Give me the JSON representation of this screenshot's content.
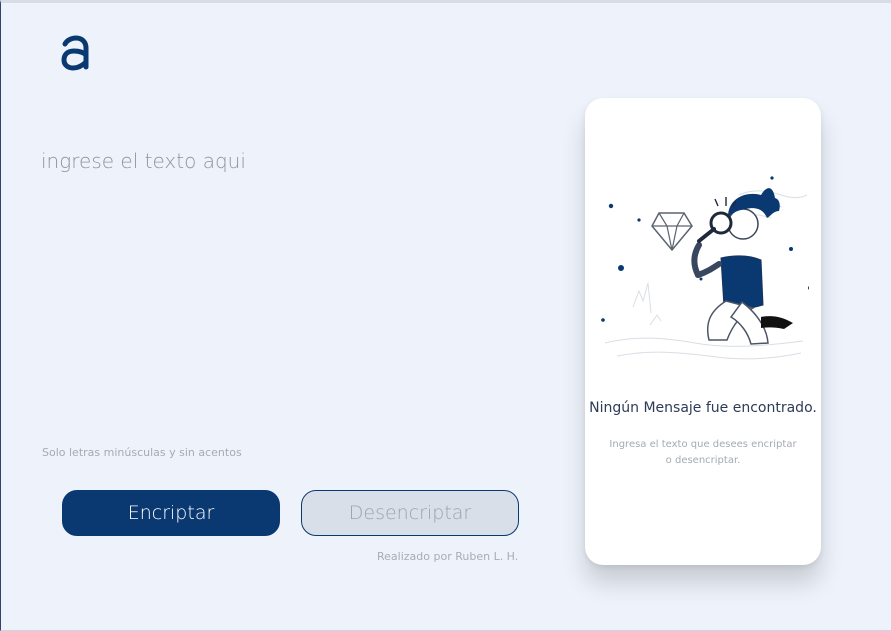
{
  "brand": {
    "logo_icon": "alura-logo-icon",
    "primary_color": "#0a3871"
  },
  "input": {
    "placeholder": "ingrese el texto aqui",
    "value": ""
  },
  "note": {
    "text": "Solo letras minúsculas y sin acentos"
  },
  "actions": {
    "encrypt_label": "Encriptar",
    "decrypt_label": "Desencriptar"
  },
  "footer": {
    "credit": "Realizado por Ruben L. H."
  },
  "result_panel": {
    "illustration_icon": "search-illustration-icon",
    "title": "Ningún Mensaje fue encontrado.",
    "description": "Ingresa el texto que desees encriptar o desencriptar."
  }
}
